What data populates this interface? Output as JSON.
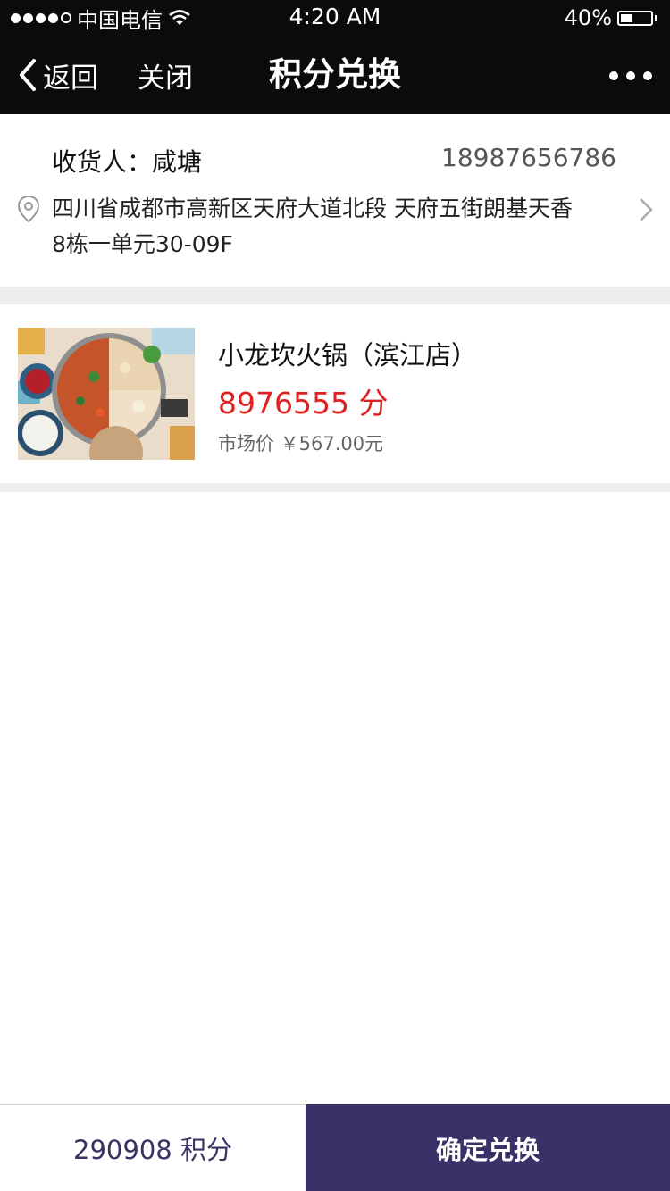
{
  "status_bar": {
    "carrier": "中国电信",
    "time": "4:20 AM",
    "battery_percent_text": "40%",
    "battery_level": 0.4,
    "signal_bars": 4
  },
  "nav": {
    "back_label": "返回",
    "close_label": "关闭",
    "title": "积分兑换"
  },
  "address": {
    "receiver": "收货人：咸塘",
    "phone": "18987656786",
    "line1": "四川省成都市高新区天府大道北段  天府五街朗基天香",
    "line2": "8栋一单元30-09F"
  },
  "product": {
    "name": "小龙坎火锅（滨江店）",
    "points": "8976555 分",
    "market_price": "市场价 ￥567.00元"
  },
  "footer": {
    "points": "290908 积分",
    "confirm_label": "确定兑换"
  },
  "colors": {
    "nav_bg": "#0b0b0b",
    "points_red": "#e02020",
    "confirm_bg": "#3b3168",
    "footer_points_text": "#3a3262"
  },
  "icons": [
    "signal-icon",
    "wifi-icon",
    "battery-icon",
    "back-chevron-icon",
    "more-dots-icon",
    "location-pin-icon",
    "chevron-right-icon"
  ]
}
